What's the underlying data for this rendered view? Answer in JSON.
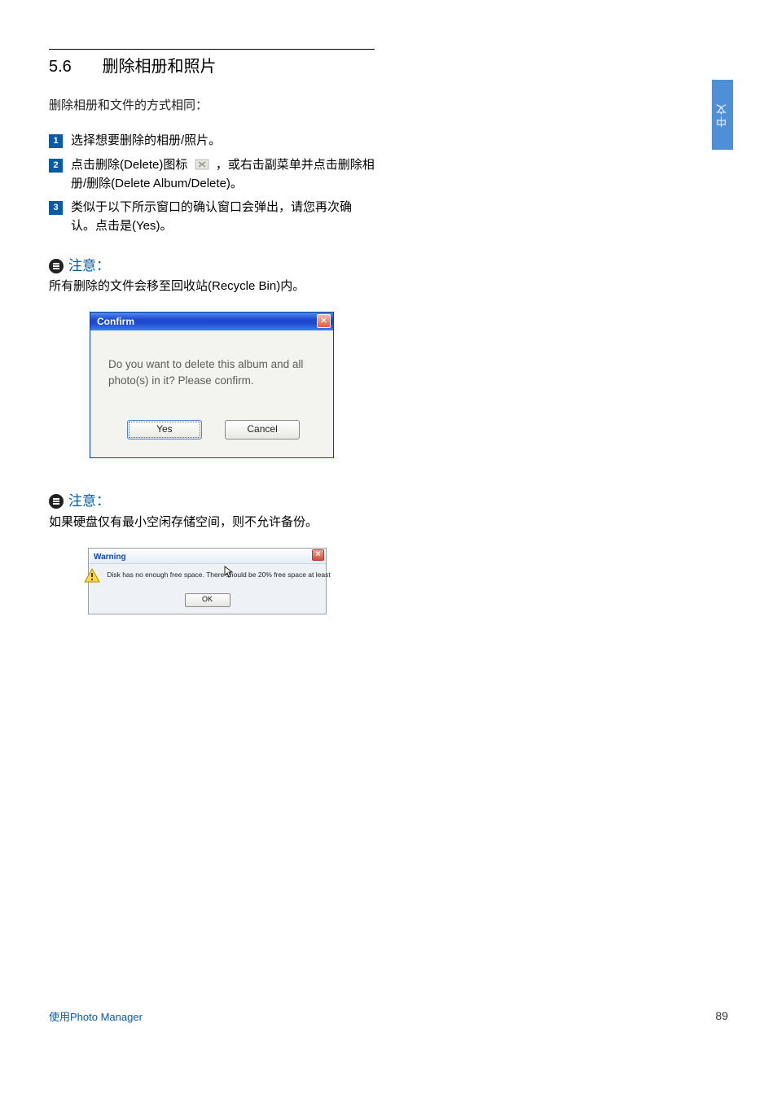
{
  "section": {
    "number": "5.6",
    "title": "删除相册和照片"
  },
  "intro": "删除相册和文件的方式相同：",
  "steps": [
    {
      "n": "1",
      "text": "选择想要删除的相册/照片。"
    },
    {
      "n": "2",
      "text_a": "点击删除(Delete)图标 ",
      "text_b": " ，或右击副菜单并点击删除相册/删除(Delete Album/Delete)。"
    },
    {
      "n": "3",
      "text": "类似于以下所示窗口的确认窗口会弹出，请您再次确认。点击是(Yes)。"
    }
  ],
  "note1": {
    "label": "注意：",
    "body": "所有删除的文件会移至回收站(Recycle Bin)内。"
  },
  "confirm_dialog": {
    "title": "Confirm",
    "message": "Do you want to delete this album and all photo(s) in it? Please confirm.",
    "yes": "Yes",
    "cancel": "Cancel"
  },
  "note2": {
    "label": "注意：",
    "body": "如果硬盘仅有最小空闲存储空间，则不允许备份。"
  },
  "warning_dialog": {
    "title": "Warning",
    "message": "Disk has no enough free space. There should be 20%  free space at least",
    "ok": "OK"
  },
  "side_tab": "中文",
  "footer": {
    "left": "使用Photo Manager",
    "right": "89"
  }
}
